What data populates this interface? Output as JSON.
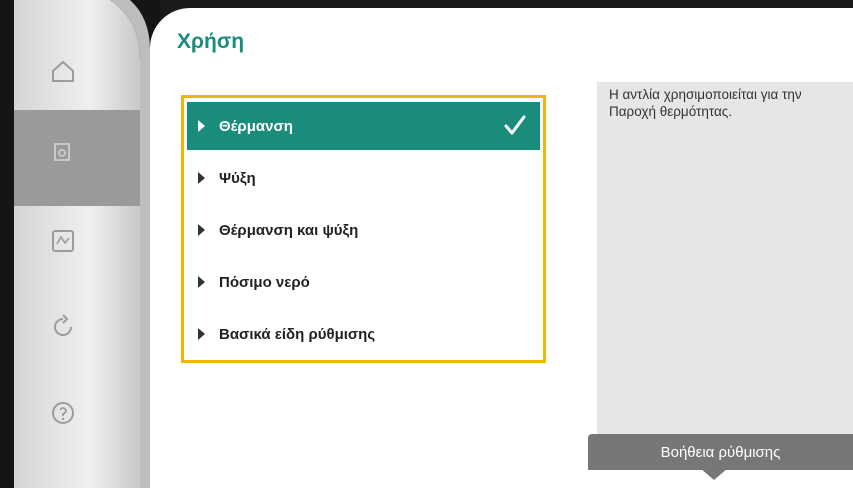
{
  "title": "Χρήση",
  "menu": {
    "items": [
      {
        "label": "Θέρμανση",
        "selected": true
      },
      {
        "label": "Ψύξη",
        "selected": false
      },
      {
        "label": "Θέρμανση και ψύξη",
        "selected": false
      },
      {
        "label": "Πόσιμο νερό",
        "selected": false
      },
      {
        "label": "Βασικά είδη ρύθμισης",
        "selected": false
      }
    ]
  },
  "info": {
    "text": "Η αντλία χρησιμοποιείται για την Παροχή θερμότητας."
  },
  "help": {
    "label": "Βοήθεια ρύθμισης"
  },
  "rail": {
    "icons": [
      "home-icon",
      "settings-icon",
      "diagnostics-icon",
      "restore-icon",
      "help-icon"
    ]
  },
  "colors": {
    "accent": "#1a8c7c",
    "highlight_border": "#f2b705",
    "panel": "#e6e6e6",
    "help_tab": "#777777"
  }
}
